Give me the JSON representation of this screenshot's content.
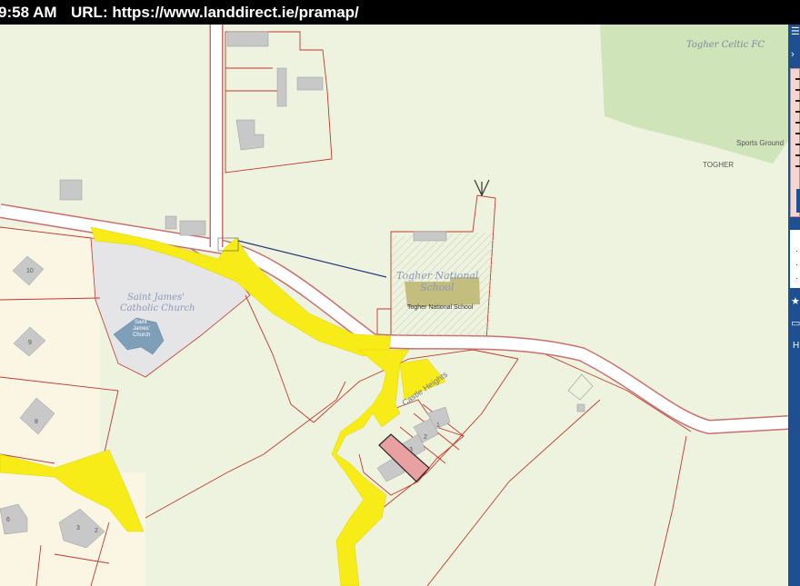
{
  "browser": {
    "time": "9:58 AM",
    "url_label": "URL:",
    "url": "https://www.landdirect.ie/pramap/"
  },
  "map": {
    "labels": {
      "togher_celtic_fc": "Togher Celtic FC",
      "sports_ground": "Sports Ground",
      "togher": "TOGHER",
      "school_title_1": "Togher National",
      "school_title_2": "School",
      "school_sub": "Togher National School",
      "church_title_1": "Saint James'",
      "church_title_2": "Catholic Church",
      "church_sub_1": "Saint",
      "church_sub_2": "James'",
      "church_sub_3": "Church",
      "castle_heights": "Castle Heights",
      "house_10": "10",
      "house_9": "9",
      "house_8": "8",
      "house_6": "6",
      "house_3": "3",
      "house_2": "2",
      "unit_1": "1",
      "unit_2": "2",
      "unit_3": "3"
    },
    "colors": {
      "field": "#eef3df",
      "road_yellow": "#f7ec18",
      "selected_parcel": "#e8a0a0",
      "boundary": "#c0392b",
      "building": "#c6c6c6"
    }
  },
  "panel": {
    "menu_icon": "menu-icon",
    "expand_icon": "chevron-right-icon",
    "star_icon": "star-icon",
    "print_icon": "print-icon",
    "help_label": "H"
  }
}
